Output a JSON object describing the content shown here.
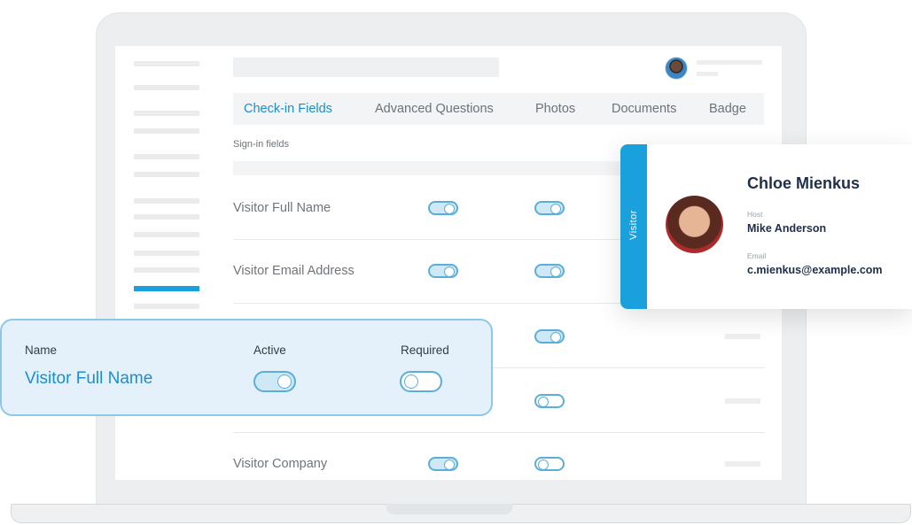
{
  "tabs": [
    {
      "label": "Check-in Fields",
      "active": true
    },
    {
      "label": "Advanced Questions",
      "active": false
    },
    {
      "label": "Photos",
      "active": false
    },
    {
      "label": "Documents",
      "active": false
    },
    {
      "label": "Badge",
      "active": false
    }
  ],
  "section_label": "Sign-in fields",
  "fields": [
    {
      "label": "Visitor Full Name",
      "active": true,
      "required": true
    },
    {
      "label": "Visitor Email Address",
      "active": true,
      "required": true
    },
    {
      "label": "",
      "active": true,
      "required": true
    },
    {
      "label": "",
      "active": false,
      "required": false
    },
    {
      "label": "Visitor Company",
      "active": true,
      "required": false
    }
  ],
  "visitor_card": {
    "tag": "Visitor",
    "name": "Chloe Mienkus",
    "host_label": "Host",
    "host": "Mike Anderson",
    "email_label": "Email",
    "email": "c.mienkus@example.com"
  },
  "field_detail": {
    "name_label": "Name",
    "active_label": "Active",
    "required_label": "Required",
    "name": "Visitor Full Name",
    "active": true,
    "required": false
  },
  "colors": {
    "accent": "#1aa0dc",
    "tab_active": "#1a8fcf",
    "card_title": "#1f2e4b",
    "detail_bg": "#e4f1fa"
  },
  "icons": [
    "user-avatar-icon",
    "toggle-switch-icon"
  ]
}
